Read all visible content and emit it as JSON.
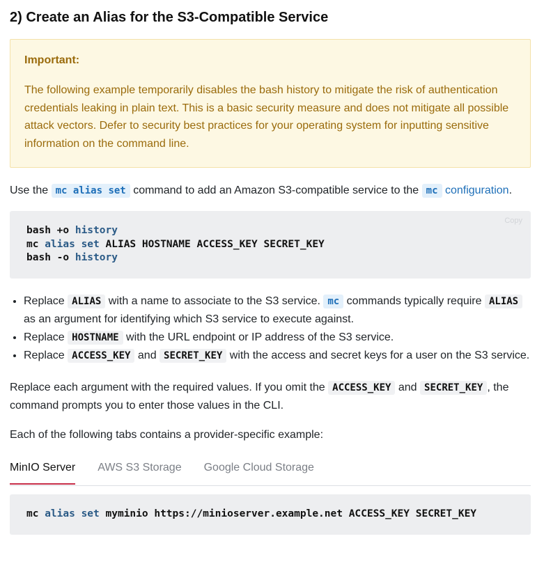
{
  "heading": "2) Create an Alias for the S3-Compatible Service",
  "important": {
    "title": "Important:",
    "text": "The following example temporarily disables the bash history to mitigate the risk of authentication credentials leaking in plain text. This is a basic security measure and does not mitigate all possible attack vectors. Defer to security best practices for your operating system for inputting sensitive information on the command line."
  },
  "intro": {
    "pre": "Use the ",
    "code1": "mc alias set",
    "mid": " command to add an Amazon S3-compatible service to the ",
    "code2": "mc",
    "link": "configuration",
    "post": "."
  },
  "codeblock1": {
    "copy_label": "Copy",
    "line1_a": "bash +o ",
    "line1_b": "history",
    "line2_a": "mc ",
    "line2_b": "alias set",
    "line2_c": " ALIAS HOSTNAME ACCESS_KEY SECRET_KEY",
    "line3_a": "bash -o ",
    "line3_b": "history"
  },
  "bullets": [
    {
      "t1": "Replace ",
      "c1": "ALIAS",
      "t2": " with a name to associate to the S3 service. ",
      "c2": "mc",
      "t3": " commands typically require ",
      "c3": "ALIAS",
      "t4": " as an argument for identifying which S3 service to execute against."
    },
    {
      "t1": "Replace ",
      "c1": "HOSTNAME",
      "t2": " with the URL endpoint or IP address of the S3 service."
    },
    {
      "t1": "Replace ",
      "c1": "ACCESS_KEY",
      "t2": " and ",
      "c2": "SECRET_KEY",
      "t3": " with the access and secret keys for a user on the S3 service."
    }
  ],
  "replace_para": {
    "t1": "Replace each argument with the required values. If you omit the ",
    "c1": "ACCESS_KEY",
    "t2": " and ",
    "c2": "SECRET_KEY",
    "t3": ", the command prompts you to enter those values in the CLI."
  },
  "tabs_intro": "Each of the following tabs contains a provider-specific example:",
  "tabs": [
    "MinIO Server",
    "AWS S3 Storage",
    "Google Cloud Storage"
  ],
  "active_tab": "MinIO Server",
  "codeblock2": {
    "a": "mc ",
    "b": "alias set",
    "c": " myminio https://minioserver.example.net ACCESS_KEY SECRET_KEY"
  },
  "colors": {
    "accent_tab": "#c72e49",
    "link": "#1e6fb8",
    "important_bg": "#fdf8e3",
    "important_text": "#9a6b0c"
  }
}
